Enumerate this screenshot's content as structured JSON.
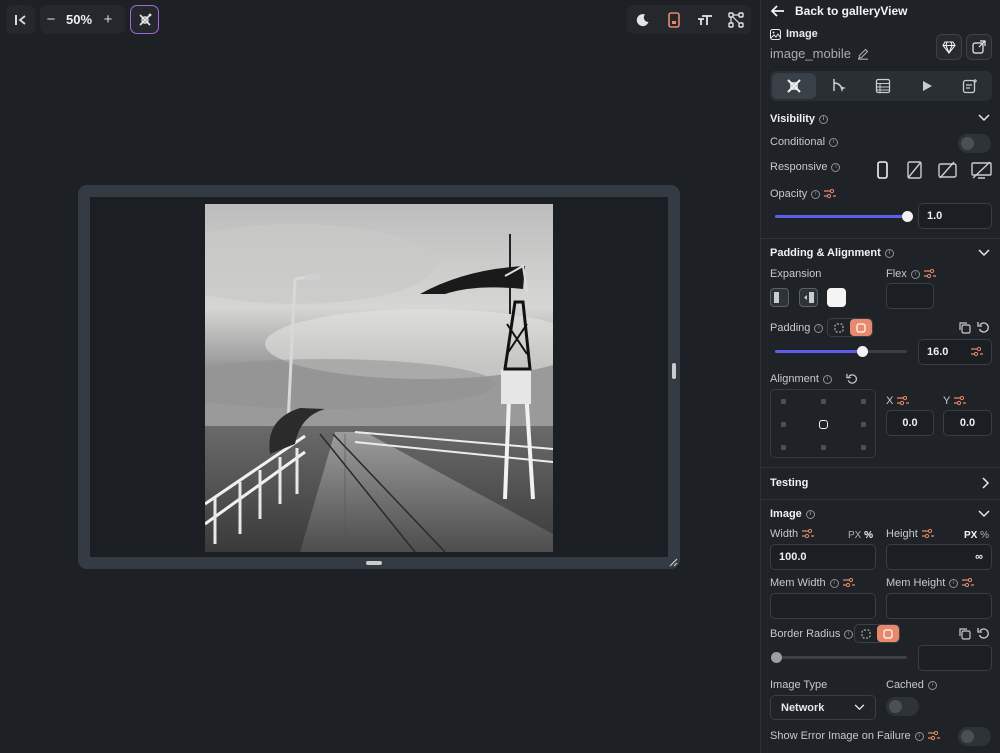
{
  "toolbar": {
    "zoom_label": "50%",
    "zoom_out": "−",
    "zoom_in": "+"
  },
  "panel": {
    "back_label": "Back to galleryView",
    "widget_type": "Image",
    "widget_name": "image_mobile",
    "visibility": {
      "title": "Visibility",
      "conditional_label": "Conditional",
      "responsive_label": "Responsive",
      "opacity_label": "Opacity",
      "opacity_value": "1.0",
      "opacity_level": 1.0
    },
    "padding_alignment": {
      "title": "Padding & Alignment",
      "expansion_label": "Expansion",
      "flex_label": "Flex",
      "padding_label": "Padding",
      "padding_value": "16.0",
      "padding_level": 0.66,
      "alignment_label": "Alignment",
      "x_label": "X",
      "x_value": "0.0",
      "y_label": "Y",
      "y_value": "0.0"
    },
    "testing": {
      "title": "Testing"
    },
    "image": {
      "title": "Image",
      "width_label": "Width",
      "width_value": "100.0",
      "height_label": "Height",
      "height_value": "∞",
      "px": "PX",
      "pct": "%",
      "mem_width_label": "Mem Width",
      "mem_height_label": "Mem Height",
      "border_radius_label": "Border Radius",
      "image_type_label": "Image Type",
      "image_type_value": "Network",
      "cached_label": "Cached",
      "show_error_label": "Show Error Image on Failure"
    }
  },
  "colors": {
    "accent": "#5b5fe8",
    "active_orange": "#e8896b",
    "panel_bg": "#1f2327",
    "canvas_bg": "#1d2125"
  },
  "icons": [
    "sidebar-collapse-icon",
    "ai-generate-icon",
    "moon-icon",
    "device-icon",
    "text-size-icon",
    "component-tree-icon",
    "back-arrow-icon",
    "image-icon",
    "edit-icon",
    "gem-icon",
    "export-icon",
    "properties-tab-icon",
    "actions-tab-icon",
    "backend-query-icon",
    "play-icon",
    "notes-icon"
  ]
}
